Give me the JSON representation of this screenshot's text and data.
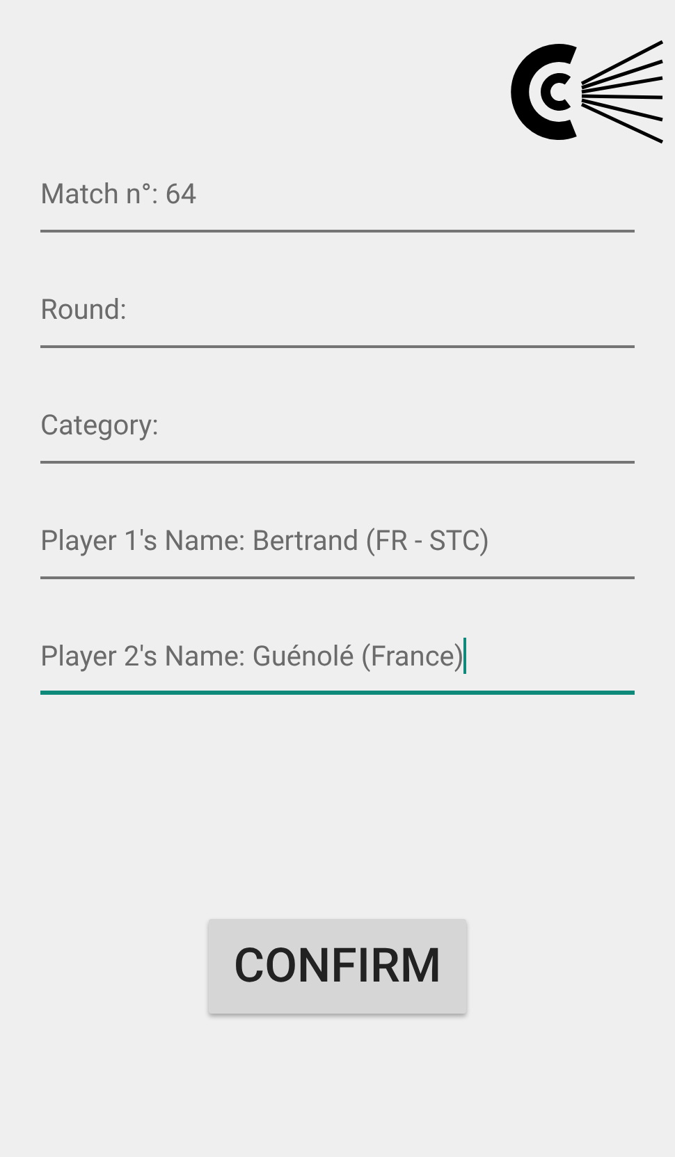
{
  "fields": [
    {
      "value": "Match n°: 64",
      "focused": false
    },
    {
      "value": "Round:",
      "focused": false
    },
    {
      "value": "Category:",
      "focused": false
    },
    {
      "value": "Player 1's Name: Bertrand (FR - STC)",
      "focused": false
    },
    {
      "value": "Player 2's Name: Guénolé (France)",
      "focused": true
    }
  ],
  "confirm_button": {
    "label": "CONFIRM"
  }
}
